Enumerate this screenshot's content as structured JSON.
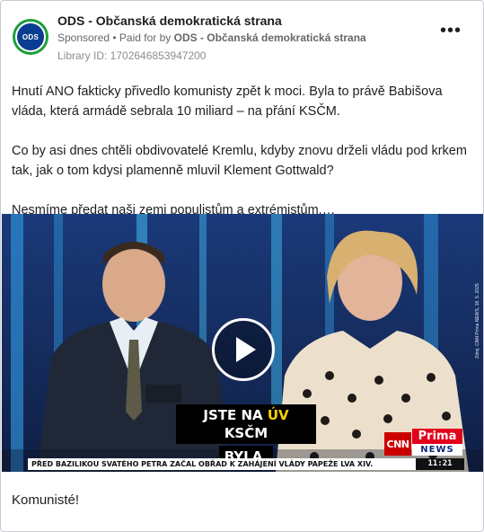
{
  "ad": {
    "page_name": "ODS - Občanská demokratická strana",
    "avatar_text": "ODS",
    "sponsored": "Sponsored",
    "paid_for_prefix": " • Paid for by ",
    "paid_for_by": "ODS - Občanská demokratická strana",
    "library_id": "Library ID: 1702646853947200",
    "more": "•••"
  },
  "post": {
    "paragraphs": [
      "Hnutí ANO fakticky přivedlo komunisty zpět k moci. Byla to právě Babišova vláda, která armádě sebrala 10 miliard – na přání KSČM.",
      "Co by asi dnes chtěli obdivovatelé Kremlu, kdyby znovu drželi vládu pod krkem tak, jak o tom kdysi plamenně mluvil Klement Gottwald?",
      "Nesmíme předat naši zemi populistům a extrémistům.…"
    ]
  },
  "video": {
    "caption_pre": "JSTE NA ",
    "caption_hl": "ÚV",
    "caption_post": " KSČM",
    "caption_line2": "BYLA.",
    "channel1": "CNN",
    "channel2_top": "Prima",
    "channel2_bottom": "NEWS",
    "ticker": "PŘED BAZILIKOU SVATÉHO PETRA ZAČAL OBŘAD K ZAHÁJENÍ VLÁDY PAPEŽE LVA XIV.",
    "time": "11:21",
    "side_credit": "Zdroj: CNN Prima NEWS, 18. 5. 2025"
  },
  "footer": {
    "headline": "Komunisté!"
  },
  "colors": {
    "brand_green": "#1f9d3a",
    "brand_blue": "#0a3d91",
    "caption_highlight": "#ffd200",
    "cnn_red": "#cc0000",
    "prima_red": "#e3001b"
  }
}
